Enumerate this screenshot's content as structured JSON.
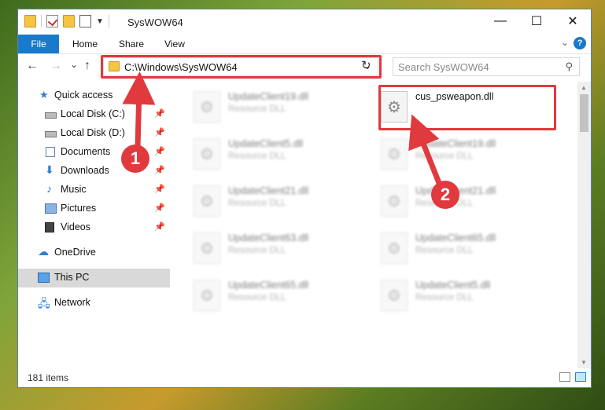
{
  "window": {
    "title": "SysWOW64",
    "controls": {
      "minimize": "—",
      "maximize": "☐",
      "close": "✕"
    }
  },
  "ribbon": {
    "tabs": [
      {
        "label": "File"
      },
      {
        "label": "Home"
      },
      {
        "label": "Share"
      },
      {
        "label": "View"
      }
    ],
    "help": "?"
  },
  "nav": {
    "back": "←",
    "forward": "→",
    "recent": "⌄",
    "up": "↑",
    "address": "C:\\Windows\\SysWOW64",
    "refresh": "↻",
    "search_placeholder": "Search SysWOW64"
  },
  "sidebar": {
    "items": [
      {
        "label": "Quick access",
        "icon": "star-icon",
        "pinned": false
      },
      {
        "label": "Local Disk (C:)",
        "icon": "drive-icon",
        "pinned": true
      },
      {
        "label": "Local Disk (D:)",
        "icon": "drive-icon",
        "pinned": true
      },
      {
        "label": "Documents",
        "icon": "documents-icon",
        "pinned": true
      },
      {
        "label": "Downloads",
        "icon": "download-icon",
        "pinned": true
      },
      {
        "label": "Music",
        "icon": "music-icon",
        "pinned": true
      },
      {
        "label": "Pictures",
        "icon": "pictures-icon",
        "pinned": true
      },
      {
        "label": "Videos",
        "icon": "videos-icon",
        "pinned": true
      },
      {
        "label": "OneDrive",
        "icon": "cloud-icon",
        "pinned": false
      },
      {
        "label": "This PC",
        "icon": "computer-icon",
        "pinned": false,
        "selected": true
      },
      {
        "label": "Network",
        "icon": "network-icon",
        "pinned": false
      }
    ]
  },
  "files": [
    {
      "name": "UpdateClient19.dll",
      "type": "Resource DLL",
      "blurred": true
    },
    {
      "name": "cus_psweapon.dll",
      "type": "",
      "blurred": false
    },
    {
      "name": "UpdateClient5.dll",
      "type": "Resource DLL",
      "blurred": true
    },
    {
      "name": "UpdateClient19.dll",
      "type": "Resource DLL",
      "blurred": true
    },
    {
      "name": "UpdateClient21.dll",
      "type": "Resource DLL",
      "blurred": true
    },
    {
      "name": "UpdateClient21.dll",
      "type": "Resource DLL",
      "blurred": true
    },
    {
      "name": "UpdateClient63.dll",
      "type": "Resource DLL",
      "blurred": true
    },
    {
      "name": "UpdateClient65.dll",
      "type": "Resource DLL",
      "blurred": true
    },
    {
      "name": "UpdateClient65.dll",
      "type": "Resource DLL",
      "blurred": true
    },
    {
      "name": "UpdateClient5.dll",
      "type": "Resource DLL",
      "blurred": true
    }
  ],
  "status": {
    "count": "181 items"
  },
  "annotations": [
    {
      "label": "1",
      "color": "#e0393e"
    },
    {
      "label": "2",
      "color": "#e0393e"
    }
  ]
}
